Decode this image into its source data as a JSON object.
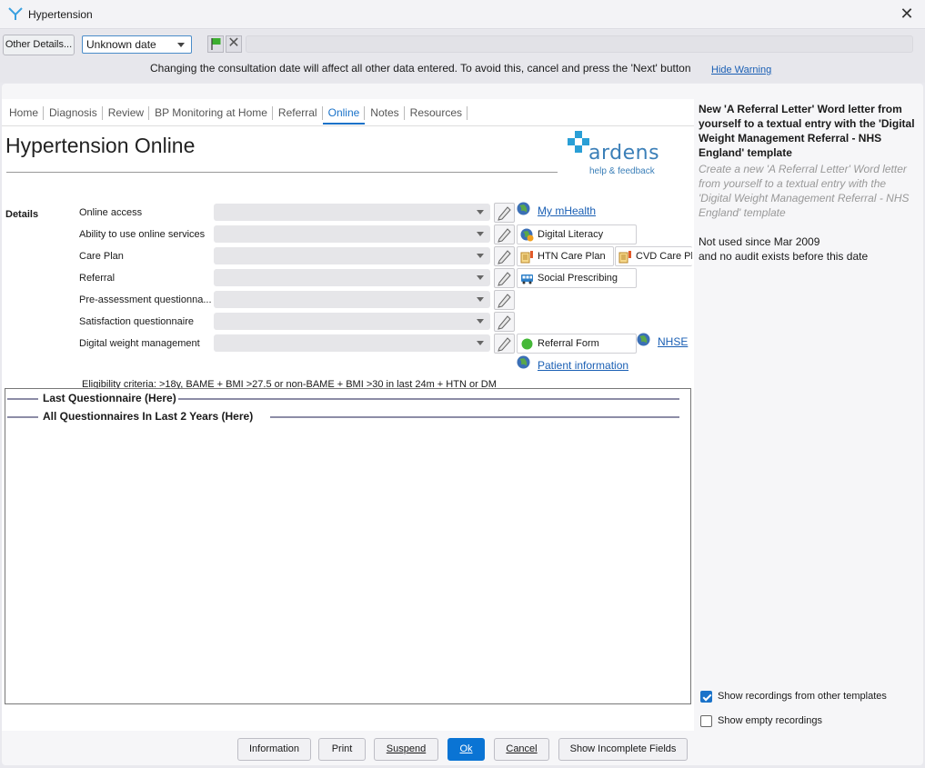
{
  "window": {
    "title": "Hypertension",
    "close_icon": "close-icon"
  },
  "toolbar": {
    "other_details_label": "Other Details...",
    "date_value": "Unknown date",
    "warning_text": "Changing the consultation date will affect all other data entered. To avoid this, cancel and press the 'Next' button",
    "hide_warning_label": "Hide Warning"
  },
  "tabs": [
    "Home",
    "Diagnosis",
    "Review",
    "BP Monitoring at Home",
    "Referral",
    "Online",
    "Notes",
    "Resources"
  ],
  "active_tab": "Online",
  "page": {
    "title": "Hypertension Online",
    "logo_text": "ardens",
    "logo_help": "help & feedback",
    "details_label": "Details"
  },
  "rows": [
    {
      "label": "Online access",
      "value": ""
    },
    {
      "label": "Ability to use online services",
      "value": ""
    },
    {
      "label": "Care Plan",
      "value": ""
    },
    {
      "label": "Referral",
      "value": ""
    },
    {
      "label": "Pre-assessment questionna...",
      "value": ""
    },
    {
      "label": "Satisfaction questionnaire",
      "value": ""
    },
    {
      "label": "Digital weight management",
      "value": ""
    }
  ],
  "resources": {
    "my_mhealth": "My mHealth",
    "digital_literacy": "Digital Literacy",
    "htn_care_plan": "HTN Care Plan",
    "cvd_care_plan": "CVD Care Pl",
    "social_prescribing": "Social Prescribing",
    "referral_form": "Referral Form",
    "nhse": "NHSE",
    "patient_information": "Patient information"
  },
  "eligibility": {
    "prefix": "Eligibility criteria: >18y, BAME + BMI ",
    "bame_threshold": ">27.5",
    "middle": " or non-BAME + BMI ",
    "non_bame_threshold": ">30",
    "suffix": " in last 24m + HTN or DM"
  },
  "questionnaires": {
    "last": "Last Questionnaire (Here)",
    "all": "All Questionnaires In Last 2 Years (Here)"
  },
  "side": {
    "header": "New 'A Referral Letter' Word letter from yourself to a textual entry with the 'Digital Weight Management Referral - NHS England' template",
    "description": "Create a new 'A Referral Letter' Word letter from yourself to a textual entry with the 'Digital Weight Management Referral - NHS England' template",
    "usage_line1": "Not used since Mar 2009",
    "usage_line2": "and no audit exists before this date",
    "show_other_label": "Show recordings from other templates",
    "show_other_checked": true,
    "show_empty_label": "Show empty recordings",
    "show_empty_checked": false
  },
  "footer": {
    "information": "Information",
    "print": "Print",
    "suspend": "Suspend",
    "ok": "Ok",
    "cancel": "Cancel",
    "show_incomplete": "Show Incomplete Fields"
  },
  "colors": {
    "accent": "#1a72c9",
    "ok_button": "#0a74d4",
    "link": "#1a5fb4",
    "logo": "#3b7fb8",
    "logo_cross": "#2a9fd6"
  }
}
